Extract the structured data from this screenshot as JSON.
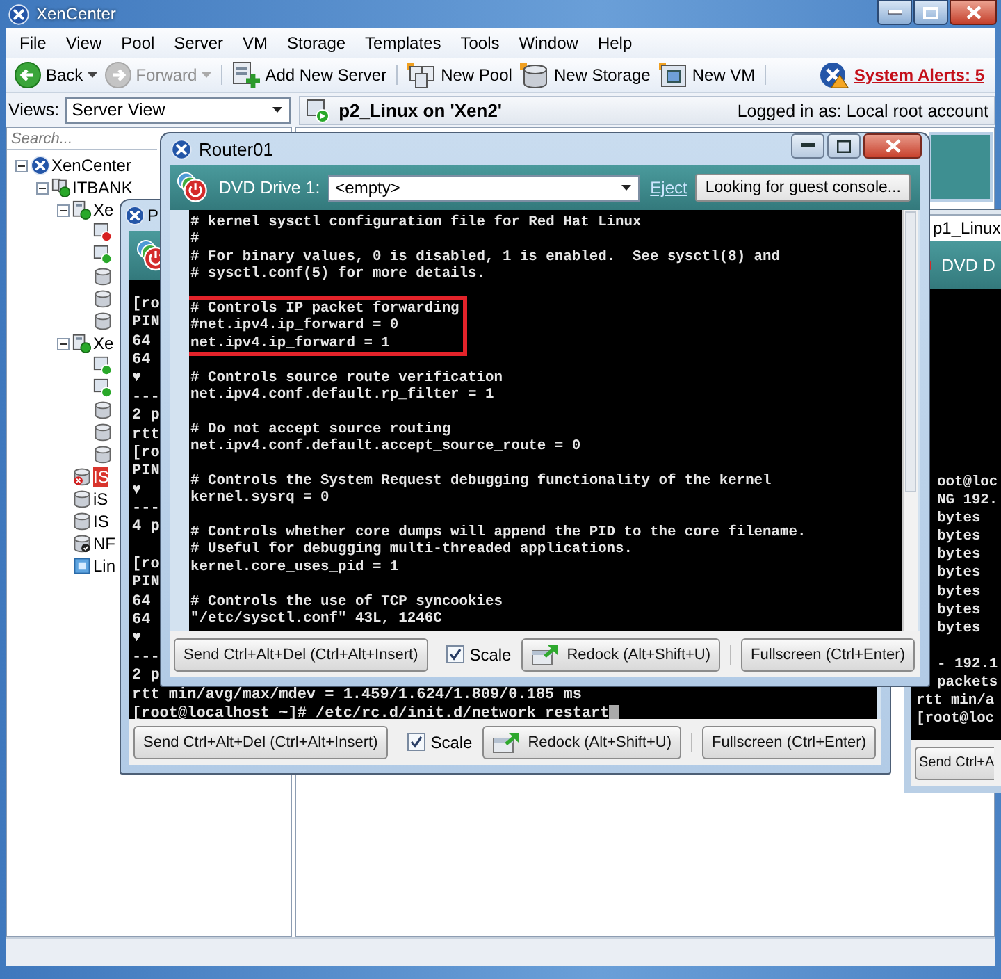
{
  "window": {
    "title": "XenCenter"
  },
  "menu": [
    "File",
    "View",
    "Pool",
    "Server",
    "VM",
    "Storage",
    "Templates",
    "Tools",
    "Window",
    "Help"
  ],
  "toolbar": [
    {
      "label": "Back",
      "kind": "back",
      "disabled": false,
      "dropdown": true,
      "separator_after": false
    },
    {
      "label": "Forward",
      "kind": "forward",
      "disabled": true,
      "dropdown": true,
      "separator_after": true
    },
    {
      "label": "Add New Server",
      "kind": "add-server",
      "disabled": false,
      "dropdown": false,
      "separator_after": true
    },
    {
      "label": "New Pool",
      "kind": "new-pool",
      "disabled": false,
      "dropdown": false,
      "separator_after": false
    },
    {
      "label": "New Storage",
      "kind": "new-storage",
      "disabled": false,
      "dropdown": false,
      "separator_after": false
    },
    {
      "label": "New VM",
      "kind": "new-vm",
      "disabled": false,
      "dropdown": false,
      "separator_after": true
    }
  ],
  "alerts": {
    "label": "System Alerts: 5"
  },
  "views": {
    "label": "Views:",
    "value": "Server View"
  },
  "search": {
    "placeholder": "Search..."
  },
  "header": {
    "title": "p2_Linux on 'Xen2'",
    "login": "Logged in as: Local root account"
  },
  "tree": [
    {
      "label": "XenCenter",
      "kind": "root",
      "expanded": true,
      "selected": false,
      "children": [
        {
          "label": "ITBANK",
          "kind": "pool",
          "expanded": true,
          "selected": false,
          "children": [
            {
              "label": "Xe",
              "kind": "host",
              "expanded": true,
              "selected": false,
              "children": [
                {
                  "kind": "vm",
                  "running": false,
                  "selected": false
                },
                {
                  "kind": "vm",
                  "running": true,
                  "selected": false
                },
                {
                  "kind": "storage",
                  "selected": false
                },
                {
                  "kind": "storage",
                  "selected": false
                },
                {
                  "kind": "storage",
                  "selected": false
                }
              ]
            },
            {
              "label": "Xe",
              "kind": "host",
              "expanded": true,
              "selected": false,
              "children": [
                {
                  "kind": "vm",
                  "running": true,
                  "selected": false
                },
                {
                  "kind": "vm",
                  "running": true,
                  "selected": false
                },
                {
                  "kind": "storage",
                  "selected": false
                },
                {
                  "kind": "storage",
                  "selected": false
                },
                {
                  "kind": "storage",
                  "selected": false
                }
              ]
            },
            {
              "label": "IS",
              "kind": "storage-error",
              "selected": true
            },
            {
              "label": "iS",
              "kind": "storage",
              "selected": false
            },
            {
              "label": "IS",
              "kind": "storage",
              "selected": false
            },
            {
              "label": "NF",
              "kind": "storage-default",
              "selected": false
            },
            {
              "label": "Lin",
              "kind": "template",
              "selected": false
            }
          ]
        }
      ]
    }
  ],
  "back_console": {
    "title": "P",
    "paragraphs": [
      {
        "lines": [
          "[ro",
          "PIN",
          "64",
          "64",
          "♥",
          "---",
          "2 p",
          "rtt",
          "[ro",
          "PIN",
          "♥",
          "---",
          "4 p"
        ],
        "highlighted": false
      },
      {
        "lines": [
          "[ro",
          "PIN",
          "64",
          "64",
          "♥",
          "---",
          "2 p",
          "rtt min/avg/max/mdev = 1.459/1.624/1.809/0.185 ms",
          "[root@localhost ~]# /etc/rc.d/init.d/network restart"
        ],
        "highlighted": false
      }
    ],
    "send_button": "Send Ctrl+Alt+Del (Ctrl+Alt+Insert)",
    "scale": {
      "label": "Scale",
      "checked": true
    },
    "redock_button": "Redock (Alt+Shift+U)",
    "fullscreen_button": "Fullscreen (Ctrl+Enter)"
  },
  "router_console": {
    "title": "Router01",
    "dvd_label": "DVD Drive 1:",
    "dvd_value": "<empty>",
    "eject": "Eject",
    "status_button": "Looking for guest console...",
    "paragraphs": [
      {
        "lines": [
          "# kernel sysctl configuration file for Red Hat Linux",
          "#",
          "# For binary values, 0 is disabled, 1 is enabled.  See sysctl(8) and",
          "# sysctl.conf(5) for more details."
        ],
        "highlighted": false
      },
      {
        "lines": [
          "# Controls IP packet forwarding",
          "#net.ipv4.ip_forward = 0",
          "net.ipv4.ip_forward = 1"
        ],
        "highlighted": true
      },
      {
        "lines": [
          "# Controls source route verification",
          "net.ipv4.conf.default.rp_filter = 1"
        ],
        "highlighted": false
      },
      {
        "lines": [
          "# Do not accept source routing",
          "net.ipv4.conf.default.accept_source_route = 0"
        ],
        "highlighted": false
      },
      {
        "lines": [
          "# Controls the System Request debugging functionality of the kernel",
          "kernel.sysrq = 0"
        ],
        "highlighted": false
      },
      {
        "lines": [
          "# Controls whether core dumps will append the PID to the core filename.",
          "# Useful for debugging multi-threaded applications.",
          "kernel.core_uses_pid = 1"
        ],
        "highlighted": false
      },
      {
        "lines": [
          "# Controls the use of TCP syncookies",
          "\"/etc/sysctl.conf\" 43L, 1246C"
        ],
        "highlighted": false
      }
    ],
    "send_button": "Send Ctrl+Alt+Del (Ctrl+Alt+Insert)",
    "scale": {
      "label": "Scale",
      "checked": true
    },
    "redock_button": "Redock (Alt+Shift+U)",
    "fullscreen_button": "Fullscreen (Ctrl+Enter)"
  },
  "side_console": {
    "tab": "p1_Linux",
    "dvd_label": "DVD D",
    "paragraphs": [
      {
        "lines": [
          "oot@loc",
          "NG 192.",
          "bytes",
          "bytes",
          "bytes",
          "bytes",
          "bytes",
          "bytes",
          "bytes"
        ],
        "highlighted": false
      },
      {
        "lines": [
          "- 192.1",
          "packets",
          "rtt min/a",
          "[root@loc"
        ],
        "highlighted": false
      }
    ],
    "send_button": "Send Ctrl+A"
  }
}
